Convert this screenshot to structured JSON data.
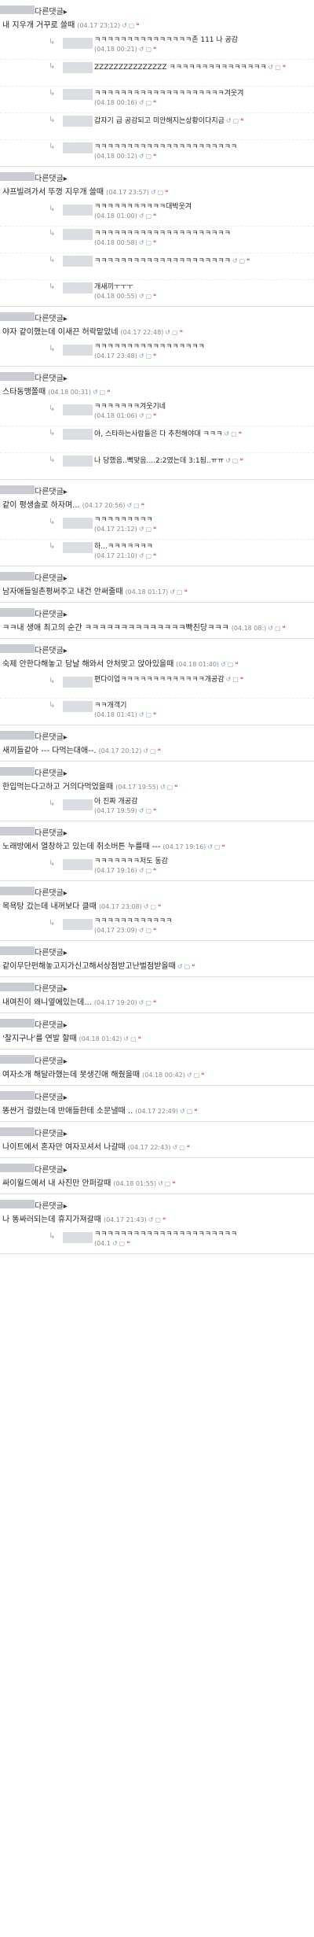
{
  "label": "다른댓글▸",
  "threads": [
    {
      "text": "내 지우개 거꾸로 쓸때",
      "time": "(04.17 23:12)",
      "replies": [
        {
          "text": "ㅋㅋㅋㅋㅋㅋㅋㅋㅋㅋㅋㅋㅋㅋㅋ존 111 나 공감",
          "time": "(04.18 00:21)"
        },
        {
          "text": "ZZZZZZZZZZZZZZZ ㅋㅋㅋㅋㅋㅋㅋㅋㅋㅋㅋㅋㅋㅋㅋ",
          "time": ""
        },
        {
          "text": "ㅋㅋㅋㅋㅋㅋㅋㅋㅋㅋㅋㅋㅋㅋㅋㅋㅋㅋㅋㅋ겨웃겨",
          "time": "(04.18 00:16)"
        },
        {
          "text": "갑자기 급 공감되고 미안해지는상황이다지금",
          "time": ""
        },
        {
          "text": "ㅋㅋㅋㅋㅋㅋㅋㅋㅋㅋㅋㅋㅋㅋㅋㅋㅋㅋㅋㅋㅋㅋ",
          "time": "(04.18 00:12)"
        }
      ]
    },
    {
      "text": "샤프빌려가서 뚜껑 지우개 쓸때",
      "time": "(04.17 23:57)",
      "replies": [
        {
          "text": "ㅋㅋㅋㅋㅋㅋㅋㅋㅋㅋㅋ대박웃겨",
          "time": "(04.18 01:00)"
        },
        {
          "text": "ㅋㅋㅋㅋㅋㅋㅋㅋㅋㅋㅋㅋㅋㅋㅋㅋㅋㅋㅋㅋㅋ",
          "time": "(04.18 00:58)"
        },
        {
          "text": "ㅋㅋㅋㅋㅋㅋㅋㅋㅋㅋㅋㅋㅋㅋㅋㅋㅋㅋㅋㅋㅋ",
          "time": ""
        },
        {
          "text": "개새끼ㅜㅜㅜ",
          "time": "(04.18 00:55)"
        }
      ]
    },
    {
      "text": "야자 같이했는데 이새끈 허락맡았네",
      "time": "(04.17 22:48)",
      "replies": [
        {
          "text": "ㅋㅋㅋㅋㅋㅋㅋㅋㅋㅋㅋㅋㅋㅋㅋㅋㅋ",
          "time": "(04.17 23:48)"
        }
      ]
    },
    {
      "text": "스타동맹쫄때",
      "time": "(04.18 00:31)",
      "replies": [
        {
          "text": "ㅋㅋㅋㅋㅋㅋㅋ겨웃기네",
          "time": "(04.18 01:06)"
        },
        {
          "text": "아, 스타하는사람들은 다 추천해야대 ㅋㅋㅋ",
          "time": ""
        },
        {
          "text": "나 당했음..뻑맞음....2:2였는데 3:1됨..ㅠㅠ",
          "time": ""
        }
      ]
    },
    {
      "text": "같이 평생솔로 하자며...",
      "time": "(04.17 20:56)",
      "replies": [
        {
          "text": "ㅋㅋㅋㅋㅋㅋㅋㅋㅋ",
          "time": "(04.17 21:12)"
        },
        {
          "text": "하...ㅋㅋㅋㅋㅋㅋㅋ",
          "time": "(04.17 21:10)"
        }
      ]
    },
    {
      "text": "남자애들일촌평써주고 내건 안써줄때",
      "time": "(04.18 01:17)",
      "replies": []
    },
    {
      "text": "ㅋㅋ내 생애 최고의 순간 ㅋㅋㅋㅋㅋㅋㅋㅋㅋㅋㅋㅋㅋㅋ빡친당ㅋㅋㅋ",
      "time": "(04.18 08:)",
      "replies": []
    },
    {
      "text": "숙제 안한다해놓고 담날 해와서 안처맞고 앉아있을때",
      "time": "(04.18 01:40)",
      "replies": [
        {
          "text": "편다이업ㅋㅋㅋㅋㅋㅋㅋㅋㅋㅋㅋㅋㅋ개공감",
          "time": ""
        },
        {
          "text": "ㅋㅋ개객기",
          "time": "(04.18 01:41)"
        }
      ]
    },
    {
      "text": "새끼들같아 --- 다먹는대애--.",
      "time": "(04.17 20:12)",
      "replies": []
    },
    {
      "text": "한입먹는다고하고 거의다먹었을때",
      "time": "(04.17 19:55)",
      "replies": [
        {
          "text": "아 진짜 개공감",
          "time": "(04.17 19:59)"
        }
      ]
    },
    {
      "text": "노래방에서 열창하고 있는데 취소버튼 누를때 ---",
      "time": "(04.17 19:16)",
      "replies": [
        {
          "text": "ㅋㅋㅋㅋㅋㅋㅋ저도 동감",
          "time": "(04.17 19:16)"
        }
      ]
    },
    {
      "text": "목욕탕 갔는데 내꺼보다 클때",
      "time": "(04.17 23:08)",
      "replies": [
        {
          "text": "ㅋㅋㅋㅋㅋㅋㅋㅋㅋㅋㅋㅋ",
          "time": "(04.17 23:09)"
        }
      ]
    },
    {
      "text": "같이무단펀해놓고지가신고해서상점받고난벌점받을때",
      "time": "",
      "replies": []
    },
    {
      "text": "내여친이 왜니옆에있는데...",
      "time": "(04.17 19:20)",
      "replies": []
    },
    {
      "text": "'찰지구나'를 연발 할때",
      "time": "(04.18 01:42)",
      "replies": []
    },
    {
      "text": "여자소개 해달라했는데 못생긴애 해줬을때",
      "time": "(04.18 00:42)",
      "replies": []
    },
    {
      "text": "똥싼거 걸렸는데 반애들한테 소문낼때 ..",
      "time": "(04.17 22:49)",
      "replies": []
    },
    {
      "text": "나이트에서 혼자만 여자꼬셔서 나갈때",
      "time": "(04.17 22:43)",
      "replies": []
    },
    {
      "text": "싸이월드에서 내 사진만 안퍼갈때",
      "time": "(04.18 01:55)",
      "replies": []
    },
    {
      "text": "나 똥싸러되는데 휴지가져갈때",
      "time": "(04.17 21:43)",
      "replies": [
        {
          "text": "ㅋㅋㅋㅋㅋㅋㅋㅋㅋㅋㅋㅋㅋㅋㅋㅋㅋㅋㅋㅋㅋㅋ",
          "time": "(04.1"
        }
      ]
    }
  ]
}
